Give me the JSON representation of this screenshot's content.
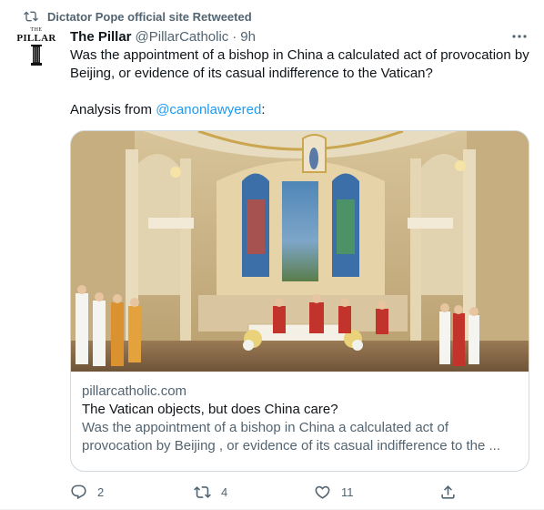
{
  "retweet": {
    "label": "Dictator Pope official site Retweeted",
    "icon": "retweet-icon"
  },
  "author": {
    "avatar_text_small": "THE",
    "avatar_text_big": "PILLAR",
    "name": "The Pillar",
    "handle": "@PillarCatholic",
    "separator": "·",
    "time": "9h"
  },
  "tweet": {
    "text": "Was the appointment of a bishop in China a calculated act of provocation by Beijing, or evidence of its casual indifference to the Vatican?",
    "analysis_prefix": "Analysis from ",
    "mention": "@canonlawyered",
    "analysis_suffix": ":"
  },
  "card": {
    "domain": "pillarcatholic.com",
    "title": "The Vatican objects, but does China care?",
    "description_line1": "Was the appointment of a bishop in China a calculated act of",
    "description_line2": "provocation by Beijing , or evidence of its casual indifference to the ..."
  },
  "actions": {
    "reply_count": "2",
    "retweet_count": "4",
    "like_count": "11"
  },
  "colors": {
    "text_primary": "#0f1419",
    "text_secondary": "#536471",
    "accent": "#1d9bf0",
    "border": "#cfd9de"
  }
}
